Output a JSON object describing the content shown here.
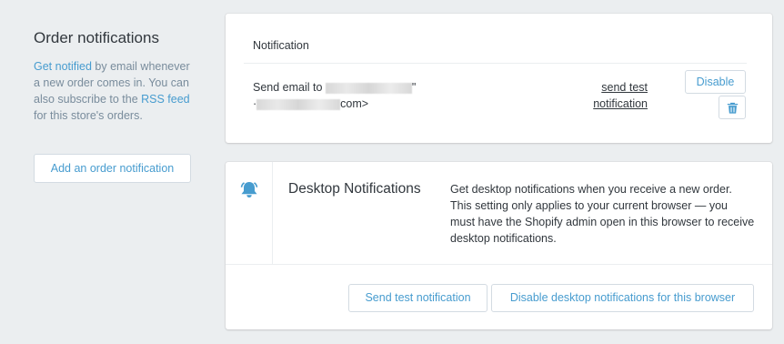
{
  "section": {
    "title": "Order notifications",
    "desc_link1": "Get notified",
    "desc_text1": " by email whenever a new order comes in. You can also subscribe to the ",
    "desc_link2": "RSS feed",
    "desc_text2": " for this store's orders.",
    "add_button": "Add an order notification"
  },
  "notifications_table": {
    "column_header": "Notification",
    "row": {
      "send_email_prefix": "Send email to ",
      "quote_close": "\"",
      "bullet": "·",
      "email_suffix": "com>",
      "send_test_label": "send test notification",
      "disable_label": "Disable",
      "delete_icon": "trash-icon"
    }
  },
  "desktop": {
    "icon": "bell-icon",
    "title": "Desktop Notifications",
    "description": "Get desktop notifications when you receive a new order. This setting only applies to your current browser — you must have the Shopify admin open in this browser to receive desktop notifications.",
    "test_button": "Send test notification",
    "disable_button": "Disable desktop notifications for this browser"
  },
  "colors": {
    "link": "#479ccf",
    "background": "#ebeef0",
    "muted_text": "#798c9c"
  }
}
